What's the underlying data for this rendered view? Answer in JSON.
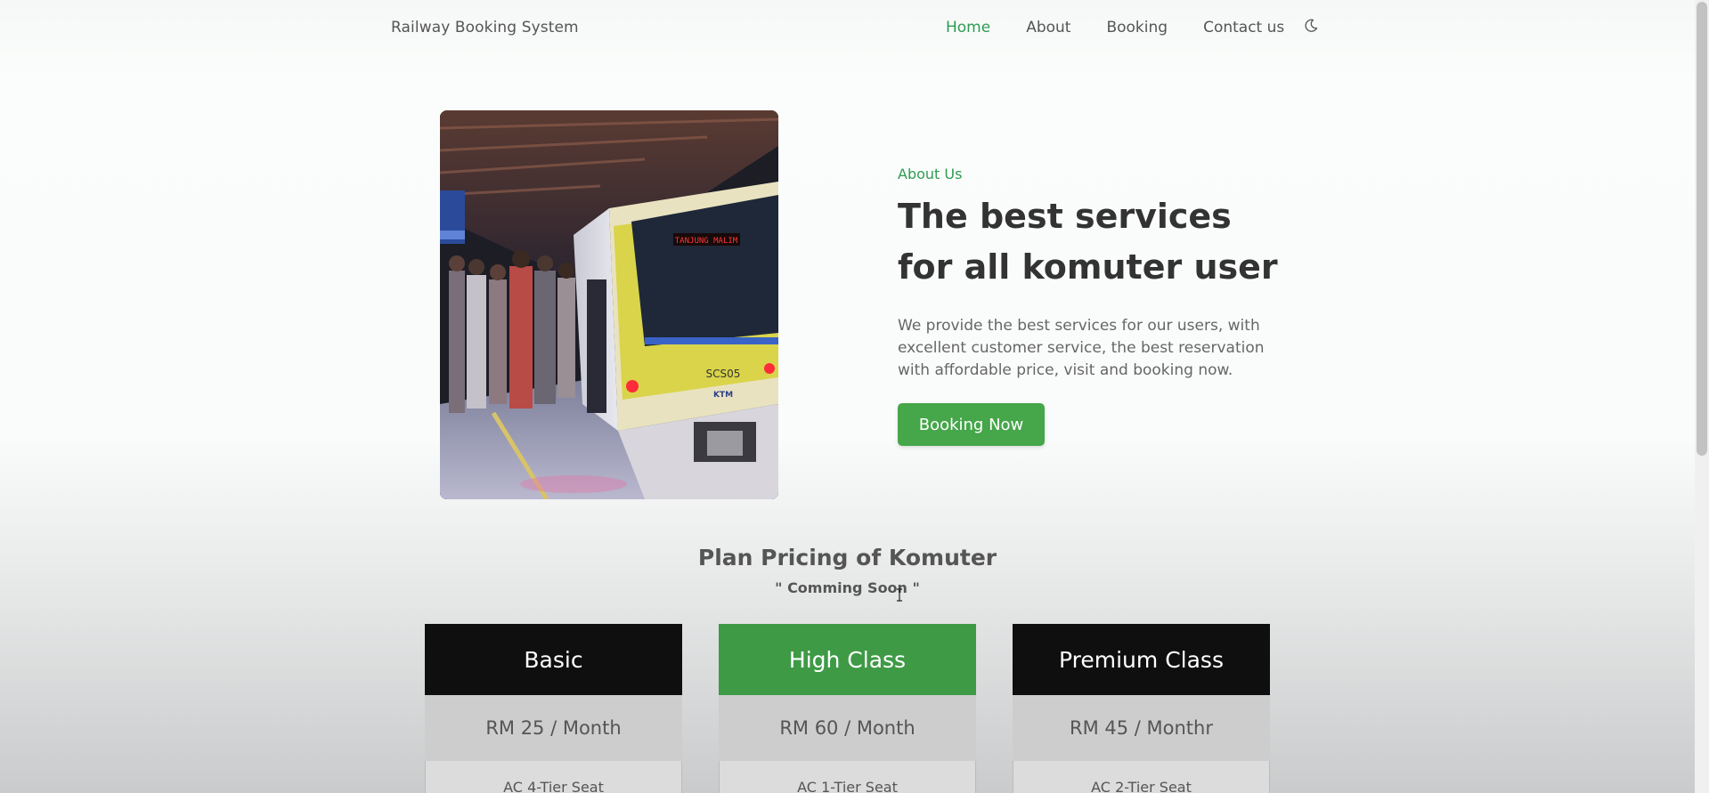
{
  "nav": {
    "brand": "Railway Booking System",
    "links": [
      {
        "label": "Home",
        "active": true
      },
      {
        "label": "About",
        "active": false
      },
      {
        "label": "Booking",
        "active": false
      },
      {
        "label": "Contact us",
        "active": false
      }
    ],
    "theme_icon": "moon-icon"
  },
  "hero": {
    "image_alt": "KTM komuter train at platform",
    "train_code": "SCS05",
    "train_logo": "KTM",
    "destination_sign": "TANJUNG MALIM",
    "kicker": "About Us",
    "title_line1": "The best services",
    "title_line2": "for all komuter user",
    "description": "We provide the best services for our users, with excellent customer service, the best reservation with affordable price, visit and booking now.",
    "cta": "Booking Now"
  },
  "pricing": {
    "title": "Plan Pricing of Komuter",
    "subtitle": "\" Comming Soon \"",
    "plans": [
      {
        "name": "Basic",
        "price": "RM 25 / Month",
        "feature": "AC 4-Tier Seat",
        "header_color": "#0f0f0f"
      },
      {
        "name": "High Class",
        "price": "RM 60 / Month",
        "feature": "AC 1-Tier Seat",
        "header_color": "#3f9a46"
      },
      {
        "name": "Premium Class",
        "price": "RM 45 / Monthr",
        "feature": "AC 2-Tier Seat",
        "header_color": "#0f0f0f"
      }
    ]
  },
  "colors": {
    "accent_green": "#2f9b53",
    "button_green": "#46a64a",
    "text_dark": "#333333"
  }
}
